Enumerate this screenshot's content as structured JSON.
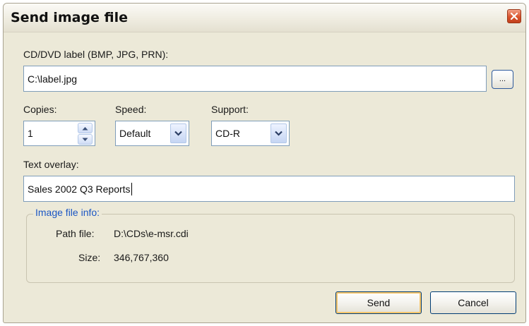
{
  "window": {
    "title": "Send image file"
  },
  "label_field": {
    "caption": "CD/DVD label (BMP, JPG, PRN):",
    "value": "C:\\label.jpg",
    "browse_label": "..."
  },
  "copies": {
    "caption": "Copies:",
    "value": "1"
  },
  "speed": {
    "caption": "Speed:",
    "selected": "Default"
  },
  "support": {
    "caption": "Support:",
    "selected": "CD-R"
  },
  "text_overlay": {
    "caption": "Text overlay:",
    "value": "Sales 2002 Q3 Reports"
  },
  "image_info": {
    "legend": "Image file info:",
    "path_label": "Path file:",
    "path_value": "D:\\CDs\\e-msr.cdi",
    "size_label": "Size:",
    "size_value": "346,767,360"
  },
  "buttons": {
    "send": "Send",
    "cancel": "Cancel"
  },
  "colors": {
    "accent_legend": "#1b56c4",
    "close_button": "#d9532c",
    "default_button_focus": "#f5c56a"
  },
  "icons": [
    "close-icon",
    "spin-up-icon",
    "spin-down-icon",
    "chevron-down-icon"
  ]
}
